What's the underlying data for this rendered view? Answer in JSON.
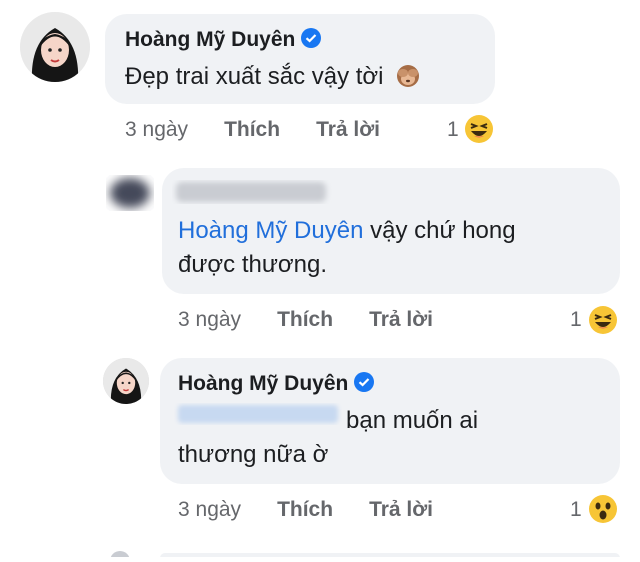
{
  "comments": [
    {
      "author": "Hoàng Mỹ Duyên",
      "text": "Đẹp trai xuất sắc vậy tời",
      "emoji": "see-no-evil-monkey",
      "time": "3 ngày",
      "like": "Thích",
      "reply": "Trả lời",
      "reaction_count": "1",
      "reaction": "laughing"
    },
    {
      "author": "",
      "mention": "Hoàng Mỹ Duyên",
      "text_line1": "vậy chứ hong",
      "text_line2": "được thương.",
      "time": "3 ngày",
      "like": "Thích",
      "reply": "Trả lời",
      "reaction_count": "1",
      "reaction": "laughing"
    },
    {
      "author": "Hoàng Mỹ Duyên",
      "text_line1": "bạn muốn ai",
      "text_line2": "thương nữa ờ",
      "time": "3 ngày",
      "like": "Thích",
      "reply": "Trả lời",
      "reaction_count": "1",
      "reaction": "wow"
    }
  ],
  "colors": {
    "bubble": "#f0f2f5",
    "mention": "#216fdb",
    "verified": "#1877f2",
    "meta": "#65676b"
  }
}
